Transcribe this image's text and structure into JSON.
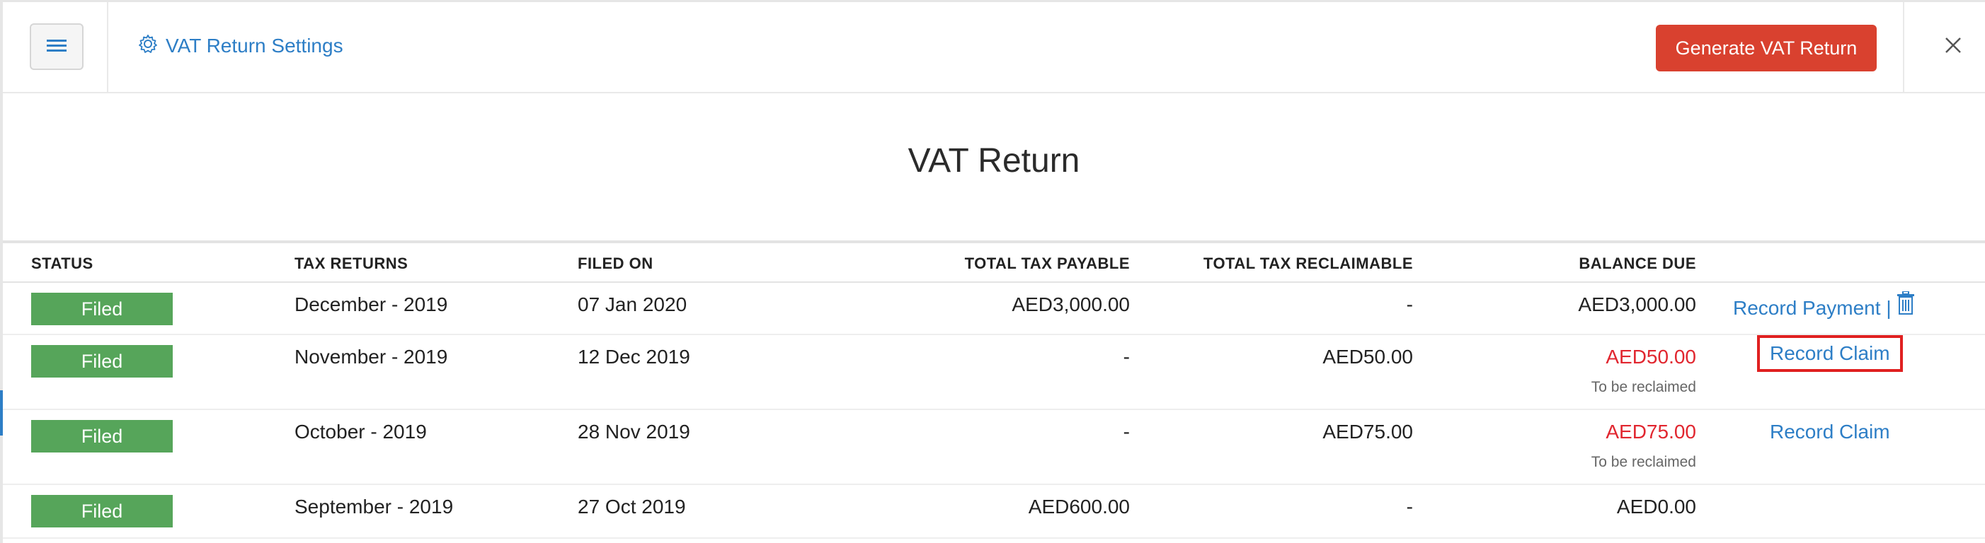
{
  "header": {
    "settings_label": "VAT Return Settings",
    "generate_label": "Generate VAT Return"
  },
  "page": {
    "title": "VAT Return"
  },
  "table": {
    "columns": {
      "status": "STATUS",
      "tax_returns": "TAX RETURNS",
      "filed_on": "FILED ON",
      "total_tax_payable": "TOTAL TAX PAYABLE",
      "total_tax_reclaimable": "TOTAL TAX RECLAIMABLE",
      "balance_due": "BALANCE DUE"
    },
    "rows": [
      {
        "status": "Filed",
        "tax_return": "December - 2019",
        "filed_on": "07 Jan 2020",
        "payable": "AED3,000.00",
        "reclaimable": "-",
        "balance": "AED3,000.00",
        "balance_note": "",
        "action": "Record Payment |"
      },
      {
        "status": "Filed",
        "tax_return": "November - 2019",
        "filed_on": "12 Dec 2019",
        "payable": "-",
        "reclaimable": "AED50.00",
        "balance": "AED50.00",
        "balance_note": "To be reclaimed",
        "action": "Record Claim"
      },
      {
        "status": "Filed",
        "tax_return": "October - 2019",
        "filed_on": "28 Nov 2019",
        "payable": "-",
        "reclaimable": "AED75.00",
        "balance": "AED75.00",
        "balance_note": "To be reclaimed",
        "action": "Record Claim"
      },
      {
        "status": "Filed",
        "tax_return": "September - 2019",
        "filed_on": "27 Oct 2019",
        "payable": "AED600.00",
        "reclaimable": "-",
        "balance": "AED0.00",
        "balance_note": "",
        "action": ""
      }
    ]
  },
  "colors": {
    "accent_blue": "#2d7ec6",
    "primary_red": "#d9412f",
    "status_green": "#56a55a",
    "negative_red": "#e1262f",
    "highlight_border": "#e02020"
  },
  "icons": {
    "menu": "hamburger-menu-icon",
    "settings": "gear-icon",
    "close": "close-icon",
    "delete": "trash-icon"
  }
}
